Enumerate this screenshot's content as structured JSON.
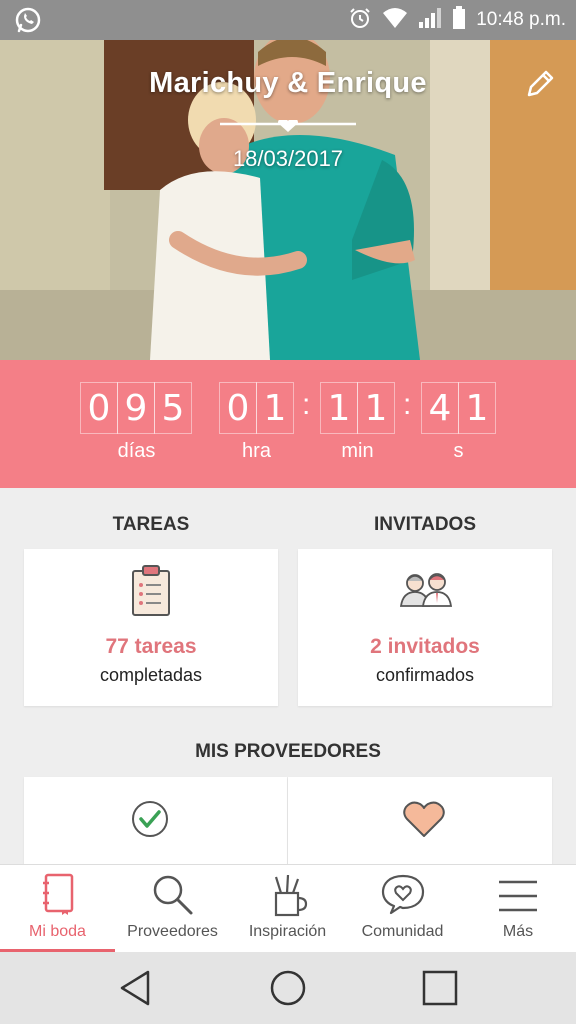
{
  "status_bar": {
    "time": "10:48 p.m.",
    "left_icon": "whatsapp-icon",
    "right_icons": [
      "alarm-icon",
      "wifi-icon",
      "signal-icon",
      "battery-icon"
    ]
  },
  "header": {
    "couple_name": "Marichuy & Enrique",
    "wedding_date": "18/03/2017",
    "edit_icon": "pencil-icon",
    "divider_icon": "heart-icon"
  },
  "countdown": {
    "days": [
      "0",
      "9",
      "5"
    ],
    "hours": [
      "0",
      "1"
    ],
    "minutes": [
      "1",
      "1"
    ],
    "seconds": [
      "4",
      "1"
    ],
    "labels": {
      "days": "días",
      "hours": "hra",
      "minutes": "min",
      "seconds": "s"
    },
    "background": "#f47f87"
  },
  "tasks": {
    "title": "TAREAS",
    "count": "77 tareas",
    "subtitle": "completadas",
    "icon": "clipboard-checklist-icon"
  },
  "guests": {
    "title": "INVITADOS",
    "count": "2 invitados",
    "subtitle": "confirmados",
    "icon": "couple-guests-icon"
  },
  "providers": {
    "title": "MIS PROVEEDORES",
    "left_icon": "check-circle-icon",
    "right_icon": "heart-icon"
  },
  "bottom_nav": {
    "items": [
      {
        "label": "Mi boda",
        "icon": "notebook-icon",
        "active": true
      },
      {
        "label": "Proveedores",
        "icon": "search-icon",
        "active": false
      },
      {
        "label": "Inspiración",
        "icon": "pencil-cup-icon",
        "active": false
      },
      {
        "label": "Comunidad",
        "icon": "chat-heart-icon",
        "active": false
      },
      {
        "label": "Más",
        "icon": "menu-icon",
        "active": false
      }
    ],
    "accent": "#e8636e"
  },
  "system_nav": {
    "buttons": [
      "back-icon",
      "home-icon",
      "recents-icon"
    ]
  }
}
